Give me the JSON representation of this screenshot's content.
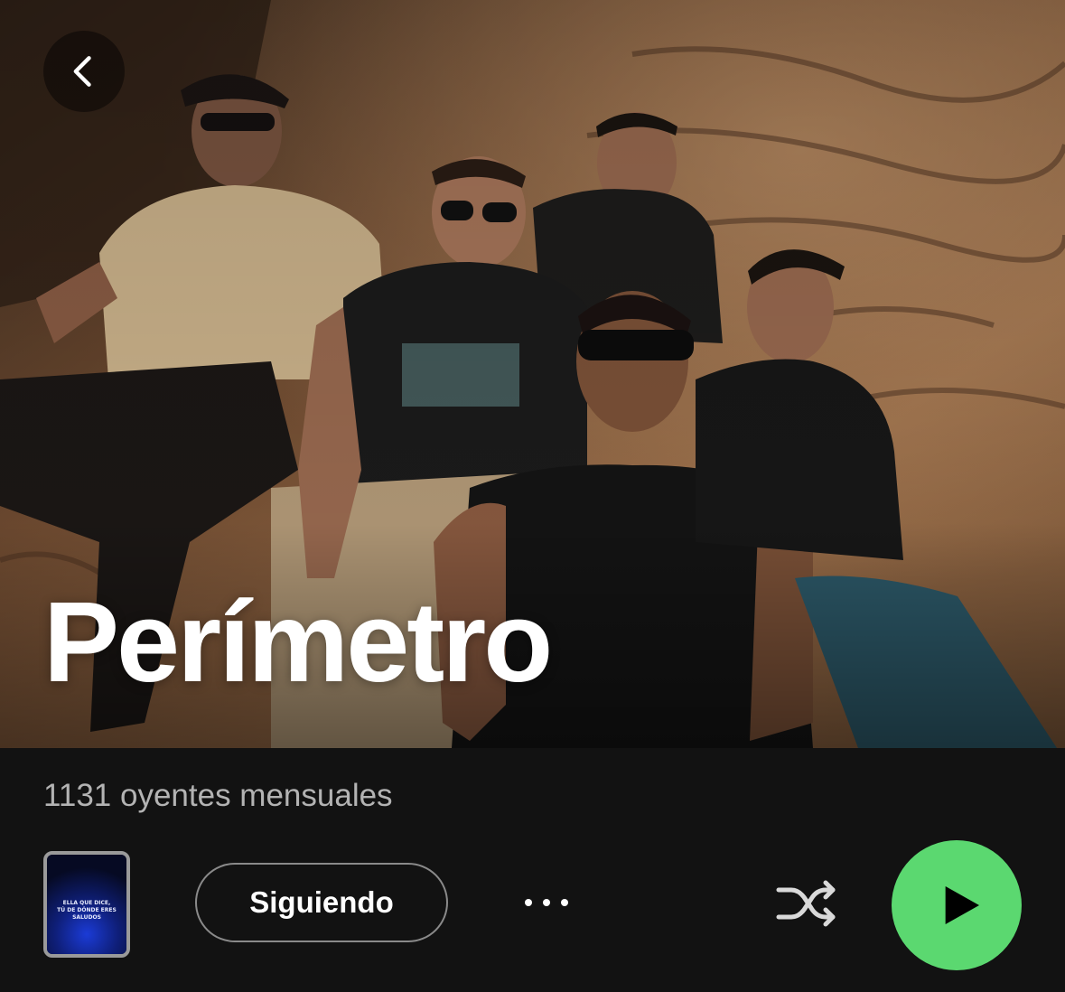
{
  "artist": {
    "name": "Perímetro",
    "monthly_listeners": "1131 oyentes mensuales"
  },
  "controls": {
    "follow_label": "Siguiendo",
    "cover_text": "ELLA QUE DICE,\nTÚ DE DÓNDE ERES\nSALUDOS"
  },
  "icons": {
    "back": "chevron-left-icon",
    "more": "more-horizontal-icon",
    "shuffle": "shuffle-icon",
    "play": "play-icon"
  },
  "colors": {
    "background": "#121212",
    "play_button": "#5bd870",
    "secondary_text": "#b3b3b3"
  }
}
